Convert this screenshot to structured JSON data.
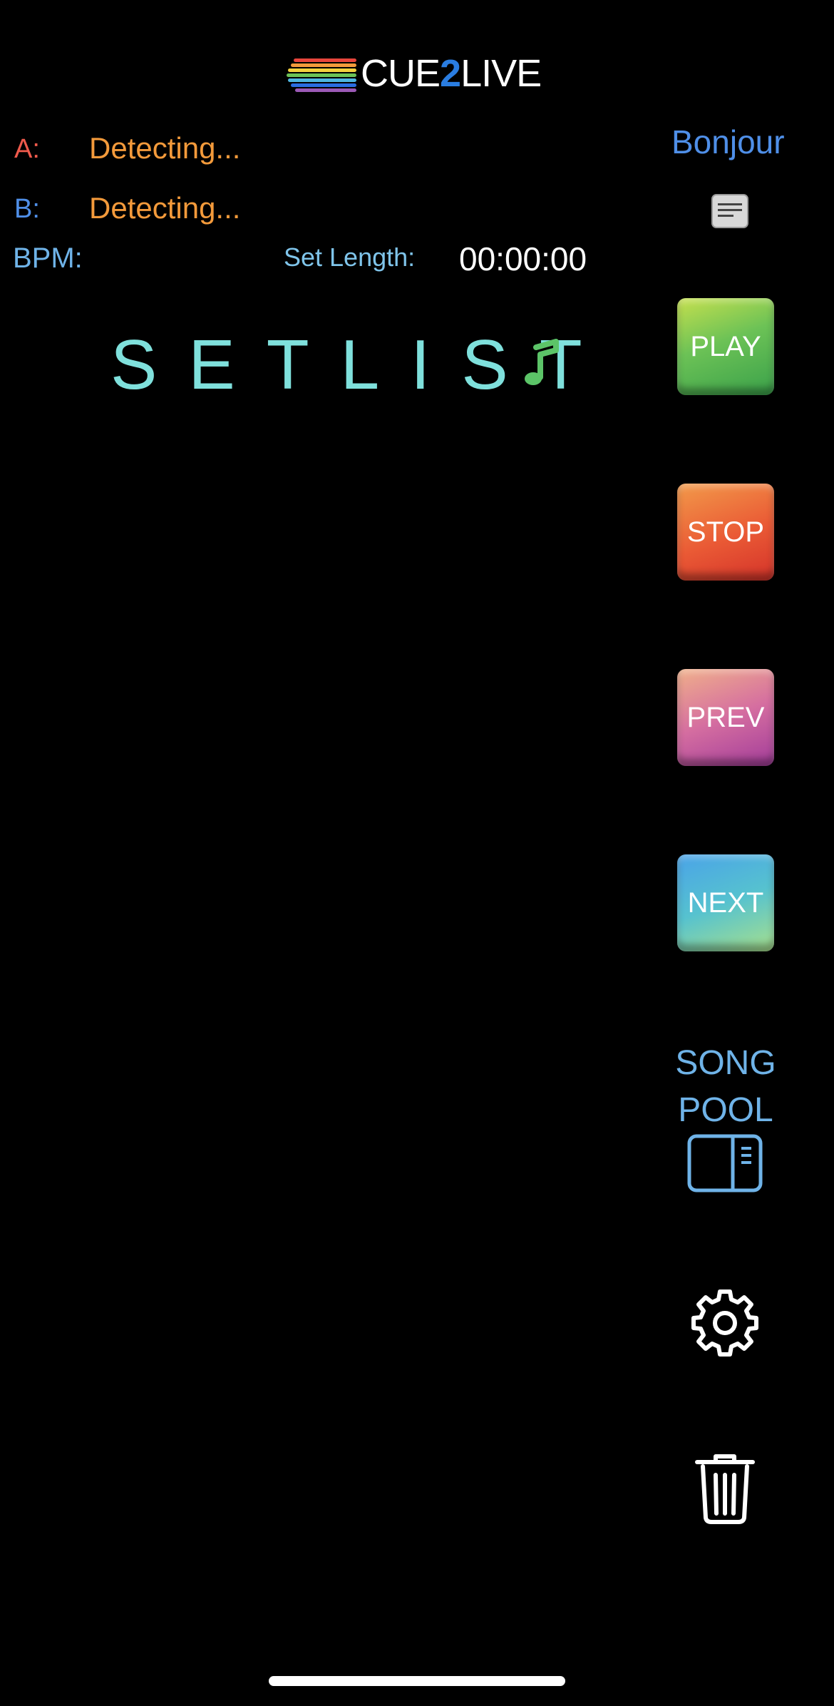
{
  "app": {
    "logo": {
      "prefix": "CUE",
      "two": "2",
      "suffix": "LIVE"
    }
  },
  "status": {
    "a_label": "A:",
    "a_value": "Detecting...",
    "b_label": "B:",
    "b_value": "Detecting...",
    "bpm_label": "BPM:",
    "set_length_label": "Set Length:",
    "set_length_value": "00:00:00",
    "greeting": "Bonjour"
  },
  "setlist": {
    "title": "SETLIST"
  },
  "controls": {
    "play": "PLAY",
    "stop": "STOP",
    "prev": "PREV",
    "next": "NEXT",
    "song_pool_line1": "SONG",
    "song_pool_line2": "POOL"
  },
  "icons": {
    "notes": "notes-icon",
    "music_note": "music-note-icon",
    "sidebar": "sidebar-panel-icon",
    "settings": "gear-icon",
    "delete": "trash-icon"
  },
  "colors": {
    "accent_blue": "#4f8fe8",
    "detecting_orange": "#f39a3b",
    "setlist_teal": "#7fe0dc",
    "note_green": "#5cc468"
  }
}
